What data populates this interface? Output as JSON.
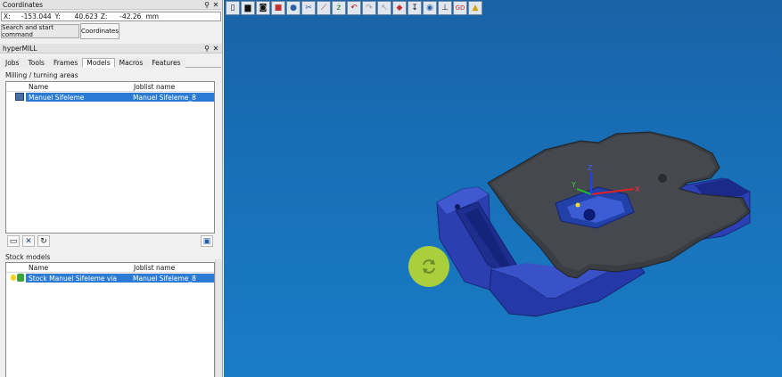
{
  "coordinates_panel": {
    "title": "Coordinates",
    "pin": "⚲",
    "close": "✕",
    "x_label": "X:",
    "x_value": "-153.044",
    "y_label": "Y:",
    "y_value": "40.623",
    "z_label": "Z:",
    "z_value": "-42.26",
    "unit": "mm",
    "search_button": "Search and start command",
    "coordinates_button": "Coordinates"
  },
  "hypermill_panel": {
    "title": "hyperMILL",
    "pin": "⚲",
    "close": "✕",
    "tabs": [
      "Jobs",
      "Tools",
      "Frames",
      "Models",
      "Macros",
      "Features"
    ],
    "active_tab": "Models",
    "milling_section": {
      "label": "Milling / turning areas",
      "col_name": "Name",
      "col_joblist": "Joblist name",
      "rows": [
        {
          "name": "Manuel Sifeleme",
          "joblist": "Manuel Sifeleme_8",
          "selected": true
        }
      ]
    },
    "stock_section": {
      "label": "Stock models",
      "col_name": "Name",
      "col_joblist": "Joblist name",
      "rows": [
        {
          "name": "Stock Manuel Sifeleme via",
          "joblist": "Manuel Sifeleme_8",
          "selected": true
        }
      ]
    }
  },
  "viewport": {
    "background_color": "#1770b8",
    "toolbar_icons": [
      "select-icon",
      "stock-icon",
      "shaded-icon",
      "color-icon",
      "sphere-icon",
      "cut-icon",
      "measure-icon",
      "text-icon",
      "undo-icon",
      "redo-icon",
      "cursor-icon",
      "cube-icon",
      "depth-icon",
      "view-icon",
      "axis-icon",
      "guide-icon",
      "pin-icon"
    ],
    "gizmo_x": "X",
    "gizmo_y": "Y",
    "gizmo_z": "Z",
    "rotate_button_color": "#a9cf3c"
  }
}
